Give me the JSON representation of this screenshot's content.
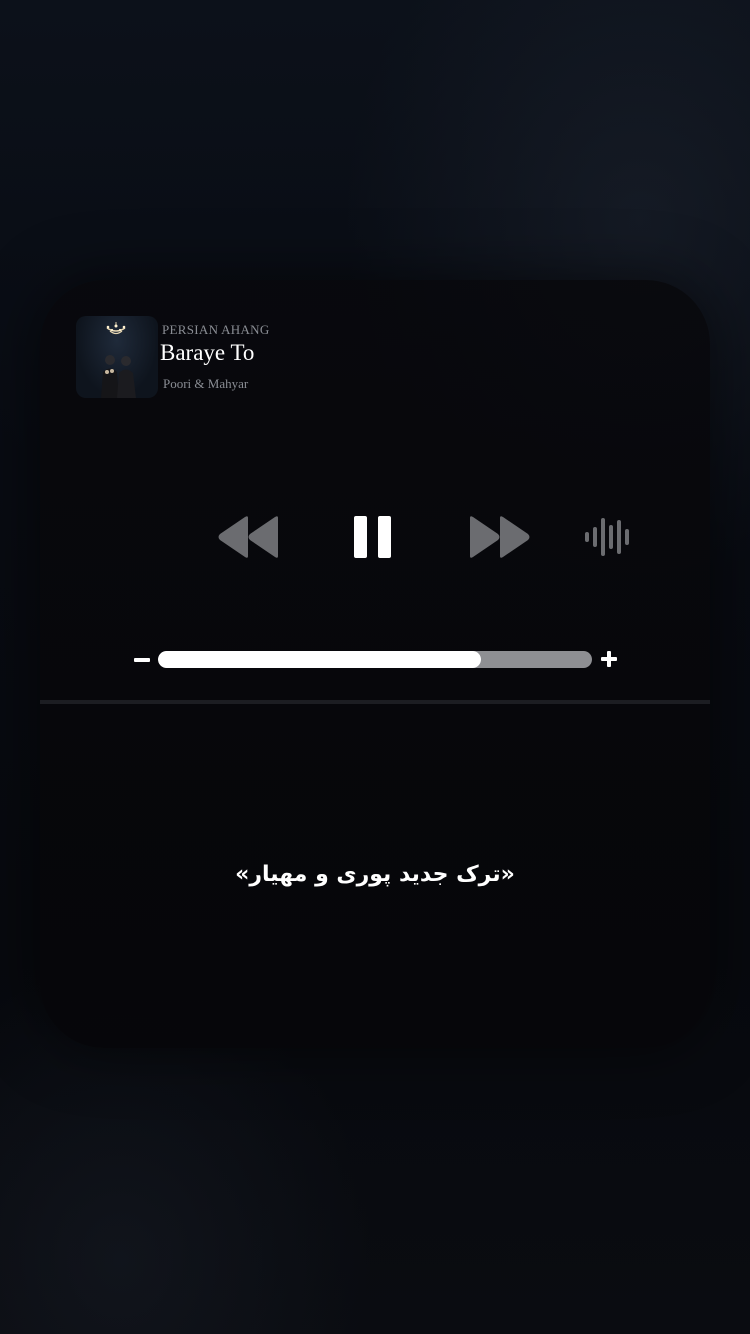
{
  "player": {
    "source": "PERSIAN AHANG",
    "title": "Baraye To",
    "artist": "Poori & Mahyar",
    "album_art_icon": "album-cover-image",
    "controls": {
      "rewind_icon": "rewind-icon",
      "pause_icon": "pause-icon",
      "forward_icon": "fast-forward-icon",
      "audio_icon": "waveform-icon"
    },
    "volume": {
      "level_fraction": 0.745,
      "minus_icon": "minus-icon",
      "plus_icon": "plus-icon"
    }
  },
  "caption": "«ترک جدید پوری و مهیار»",
  "colors": {
    "background": "#06080d",
    "card": "#08080c",
    "text_primary": "#ffffff",
    "text_secondary": "#8a8d94",
    "control_inactive": "#6b6c70",
    "volume_track": "#8e8f93",
    "volume_fill": "#ffffff"
  }
}
